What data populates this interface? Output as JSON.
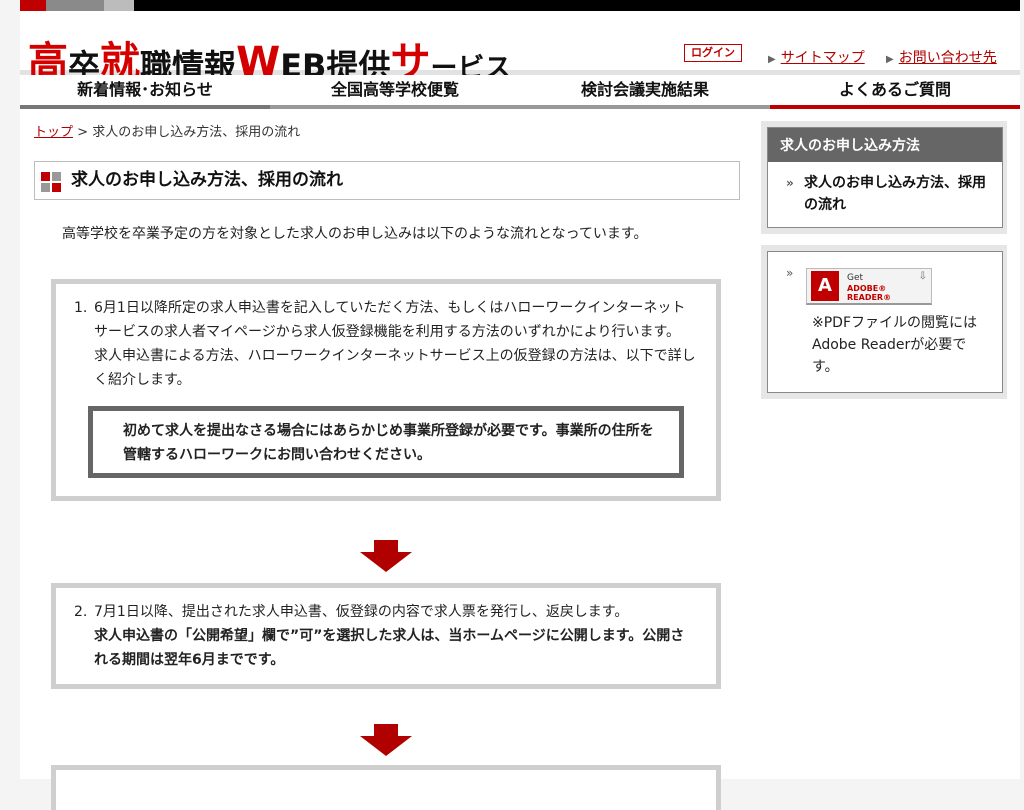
{
  "site": {
    "logo": {
      "parts": [
        "高",
        "卒",
        "就",
        "職",
        "情",
        "報",
        "W",
        "EB",
        "提",
        "供",
        "サ",
        "ービス"
      ]
    },
    "login_label": "ログイン",
    "links": [
      "サイトマップ",
      "お問い合わせ先"
    ]
  },
  "nav": {
    "items": [
      "新着情報･お知らせ",
      "全国高等学校便覧",
      "検討会議実施結果",
      "よくあるご質問"
    ]
  },
  "breadcrumb": {
    "home": "トップ",
    "separator": " > ",
    "current": "求人のお申し込み方法、採用の流れ"
  },
  "page": {
    "title": "求人のお申し込み方法、採用の流れ",
    "intro": "高等学校を卒業予定の方を対象とした求人のお申し込みは以下のような流れとなっています。"
  },
  "steps": [
    {
      "number": "1.",
      "text": "6月1日以降所定の求人申込書を記入していただく方法、もしくはハローワークインターネットサービスの求人者マイページから求人仮登録機能を利用する方法のいずれかにより行います。",
      "text2": "求人申込書による方法、ハローワークインターネットサービス上の仮登録の方法は、以下で詳しく紹介します。",
      "notice": "初めて求人を提出なさる場合にはあらかじめ事業所登録が必要です。事業所の住所を管轄するハローワークにお問い合わせください。"
    },
    {
      "number": "2.",
      "text": "7月1日以降、提出された求人申込書、仮登録の内容で求人票を発行し、返戻します。",
      "bold": "求人申込書の「公開希望」欄で”可”を選択した求人は、当ホームページに公開します。公開される期間は翌年6月までです。"
    }
  ],
  "sidebar": {
    "box1": {
      "heading": "求人のお申し込み方法",
      "link": "求人のお申し込み方法、採用の流れ"
    },
    "box2": {
      "adobe_get": "Get",
      "adobe_reader": "ADOBE® READER®",
      "note": "※PDFファイルの閲覧にはAdobe Readerが必要です。"
    }
  },
  "colors": {
    "accent_red": "#c00000",
    "nav_gray": "#777777",
    "sidebar_head": "#666666"
  }
}
